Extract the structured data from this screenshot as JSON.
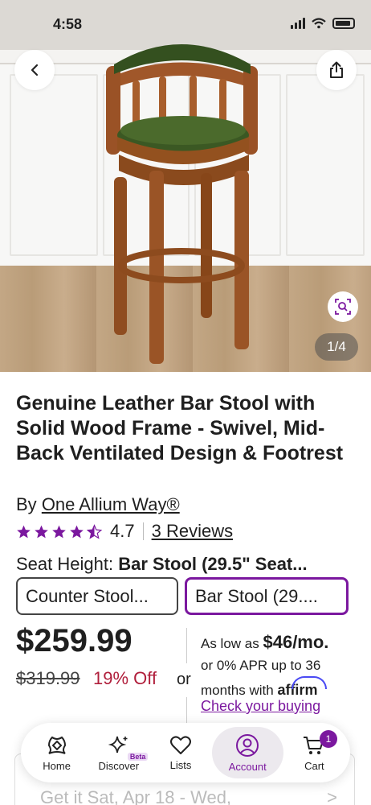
{
  "status_bar": {
    "time": "4:58"
  },
  "gallery": {
    "page_counter": "1/4"
  },
  "product": {
    "title": "Genuine Leather Bar Stool with Solid Wood Frame - Swivel, Mid-Back Ventilated Design & Footrest",
    "by_prefix": "By",
    "brand": "One Allium Way®",
    "rating": "4.7",
    "stars": 4.5,
    "reviews_link": "3 Reviews",
    "option_label": "Seat Height:",
    "option_value": "Bar Stool (29.5\" Seat...",
    "options": [
      {
        "label": "Counter Stool...",
        "selected": false
      },
      {
        "label": "Bar Stool (29....",
        "selected": true
      }
    ]
  },
  "pricing": {
    "price": "$259.99",
    "original_price": "$319.99",
    "discount": "19% Off",
    "or": "or",
    "affirm_prefix": "As low as",
    "affirm_amount": "$46/mo.",
    "affirm_detail": "or 0% APR up to 36 months with",
    "affirm_brand": "affirm",
    "affirm_link": "Check your buying"
  },
  "delivery": {
    "text": "Get it Sat, Apr 18 - Wed,",
    "chevron": ">"
  },
  "bottom_nav": {
    "items": [
      {
        "label": "Home",
        "icon": "home-icon"
      },
      {
        "label": "Discover",
        "icon": "sparkle-icon",
        "badge": "Beta"
      },
      {
        "label": "Lists",
        "icon": "heart-icon"
      },
      {
        "label": "Account",
        "icon": "user-icon",
        "active": true
      },
      {
        "label": "Cart",
        "icon": "cart-icon",
        "badge": "1"
      }
    ]
  },
  "colors": {
    "accent": "#7b189f",
    "discount": "#b01e3b",
    "affirm_blue": "#4a4af4"
  }
}
